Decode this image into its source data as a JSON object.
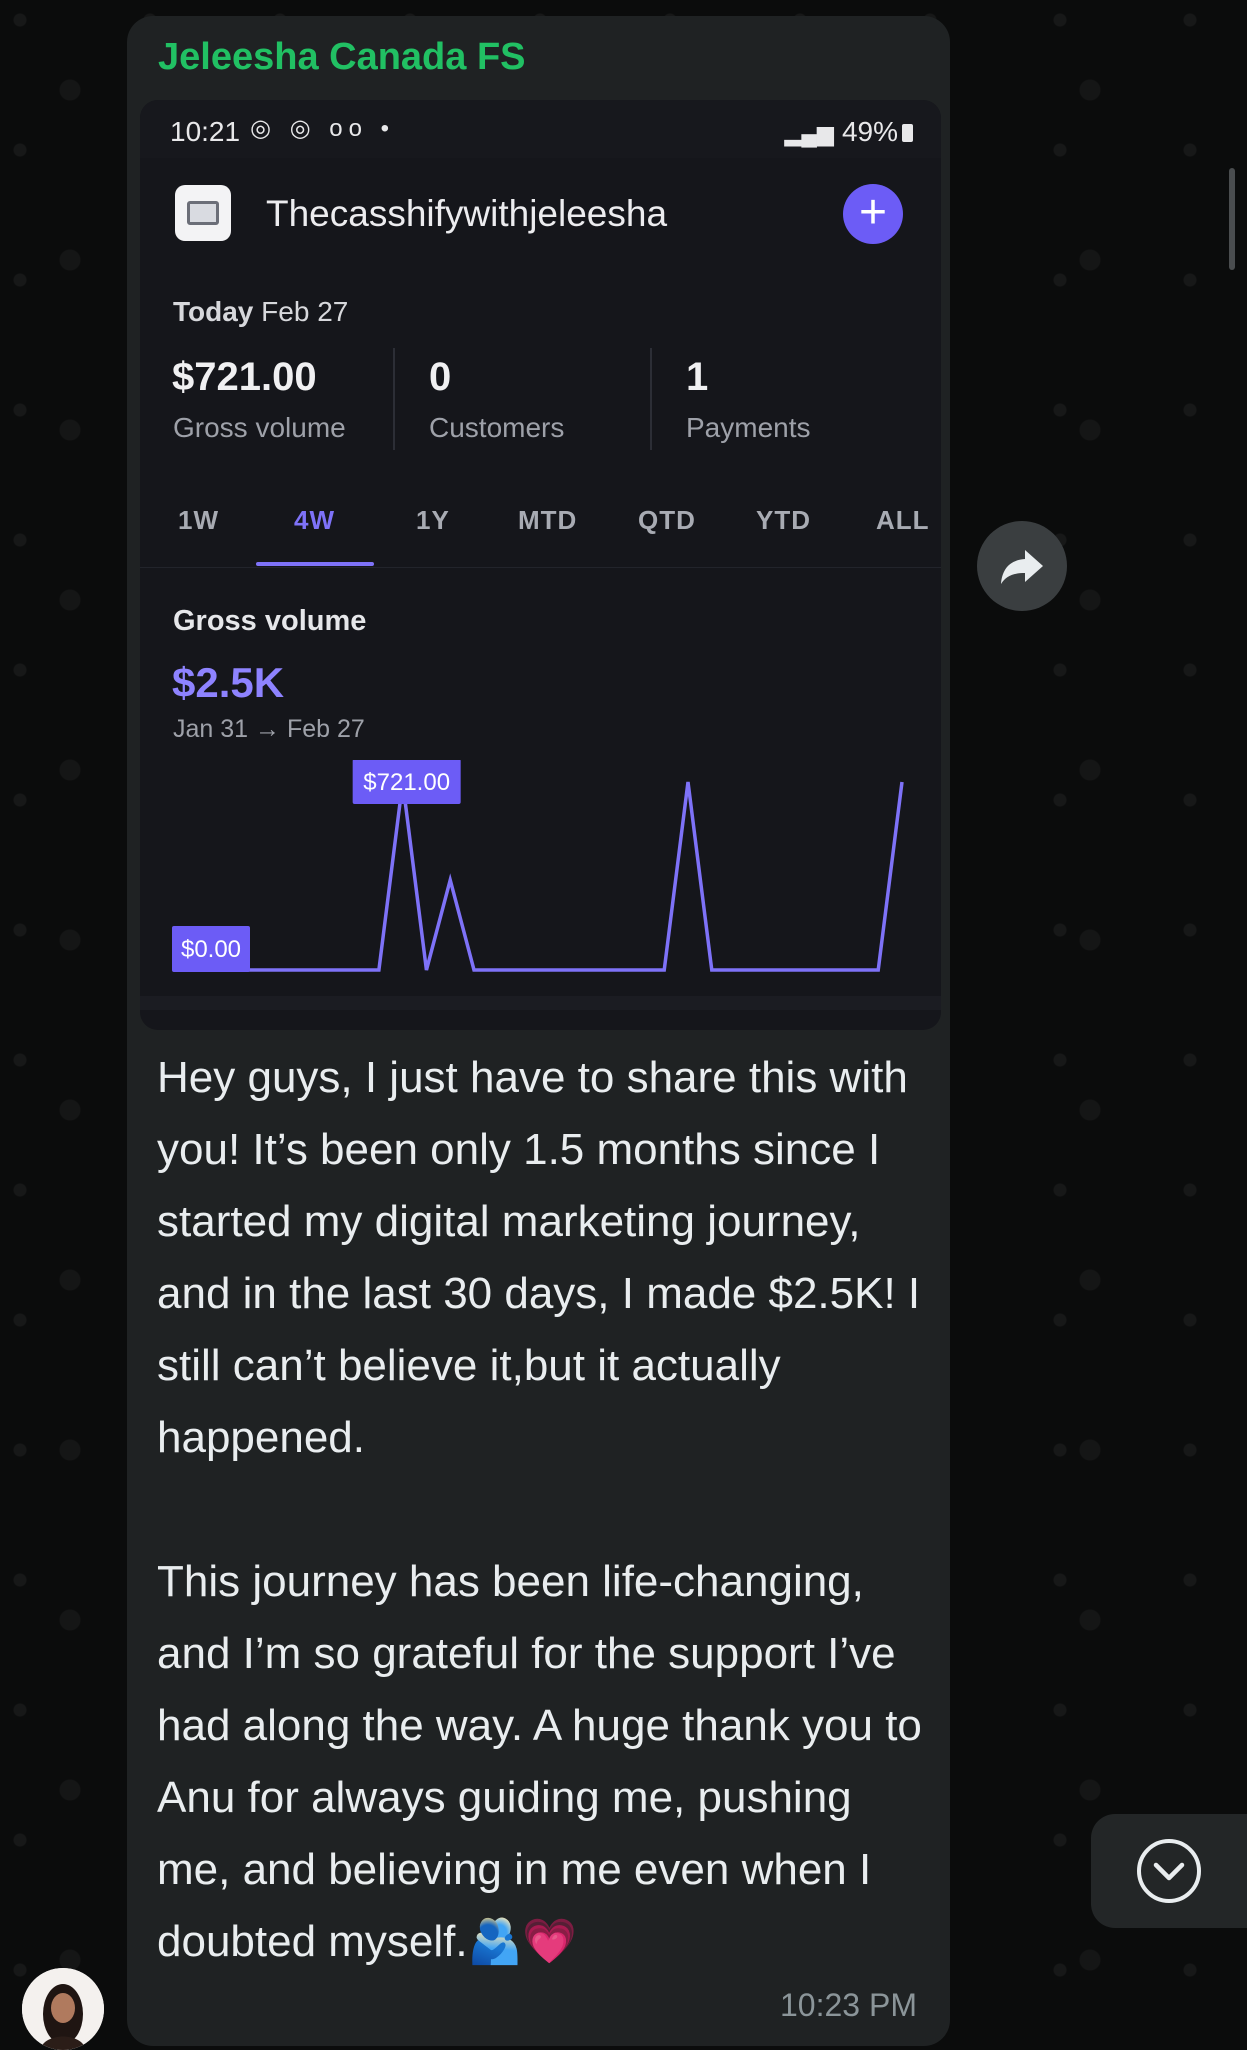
{
  "message": {
    "sender": "Jeleesha Canada FS",
    "text": "Hey guys, I just have to share this with you! It’s been only 1.5 months since I started my digital marketing journey, and in the last 30 days, I made $2.5K! I still can’t believe it,but it actually happened.\n\nThis journey has been life-changing, and I’m so grateful for the support I’ve had along the way. A huge thank you to Anu for always guiding me, pushing me, and believing in me even when I doubted myself.",
    "emoji": "🫂💗",
    "time": "10:23 PM"
  },
  "screenshot": {
    "status_bar": {
      "time": "10:21",
      "icons": "◎ ◎ ᴏᴏ •",
      "battery": "49%"
    },
    "account_name": "Thecasshifywithjeleesha",
    "today_label": "Today",
    "today_date": "Feb 27",
    "stats": [
      {
        "value": "$721.00",
        "label": "Gross volume"
      },
      {
        "value": "0",
        "label": "Customers"
      },
      {
        "value": "1",
        "label": "Payments"
      }
    ],
    "tabs": [
      {
        "label": "1W",
        "active": false
      },
      {
        "label": "4W",
        "active": true
      },
      {
        "label": "1Y",
        "active": false
      },
      {
        "label": "MTD",
        "active": false
      },
      {
        "label": "QTD",
        "active": false
      },
      {
        "label": "YTD",
        "active": false
      },
      {
        "label": "ALL",
        "active": false
      }
    ],
    "gross_volume_title": "Gross volume",
    "gross_volume_total": "$2.5K",
    "date_range": "Jan 31 → Feb 27",
    "chart_data": {
      "type": "line",
      "series": [
        {
          "values": [
            0,
            0,
            0,
            0,
            0,
            0,
            721,
            0,
            345,
            0,
            0,
            0,
            0,
            0,
            0,
            0,
            0,
            0,
            721,
            0,
            0,
            0,
            0,
            0,
            0,
            0,
            0,
            721
          ]
        }
      ],
      "peak_label": "$721.00",
      "baseline_label": "$0.00",
      "color": "#7e72f8"
    }
  },
  "icons": {
    "forward": "forward-arrow-icon",
    "scroll_down": "chevron-down-circle-icon"
  }
}
